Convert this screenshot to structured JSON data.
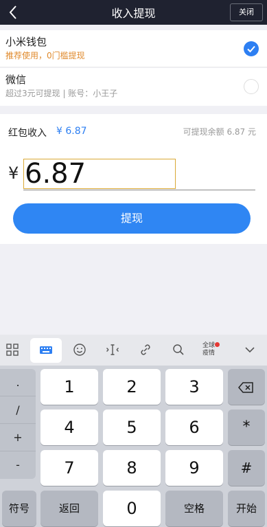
{
  "header": {
    "title": "收入提现",
    "close_label": "关闭"
  },
  "options": [
    {
      "title": "小米钱包",
      "subtitle": "推荐使用，0门槛提现",
      "selected": true
    },
    {
      "title": "微信",
      "subtitle": "超过3元可提现 | 账号：小王子",
      "selected": false
    }
  ],
  "withdraw": {
    "redpack_label": "红包收入",
    "redpack_amount": "¥ 6.87",
    "available_text": "可提现余额 6.87 元",
    "currency": "¥",
    "amount_value": "6.87",
    "button_label": "提现"
  },
  "keyboard": {
    "news_badge": "全球\n疫情",
    "symbols": [
      ".",
      "/",
      "+",
      "-"
    ],
    "digits": [
      "1",
      "2",
      "3",
      "4",
      "5",
      "6",
      "7",
      "8",
      "9"
    ],
    "star": "*",
    "hash": "#",
    "bottom": {
      "symbols": "符号",
      "back": "返回",
      "zero": "0",
      "space": "空格",
      "go": "开始"
    }
  },
  "colors": {
    "header_bg": "#1f2230",
    "accent": "#2d7ff2",
    "recommend": "#e08a2c",
    "input_border": "#d9a834"
  }
}
